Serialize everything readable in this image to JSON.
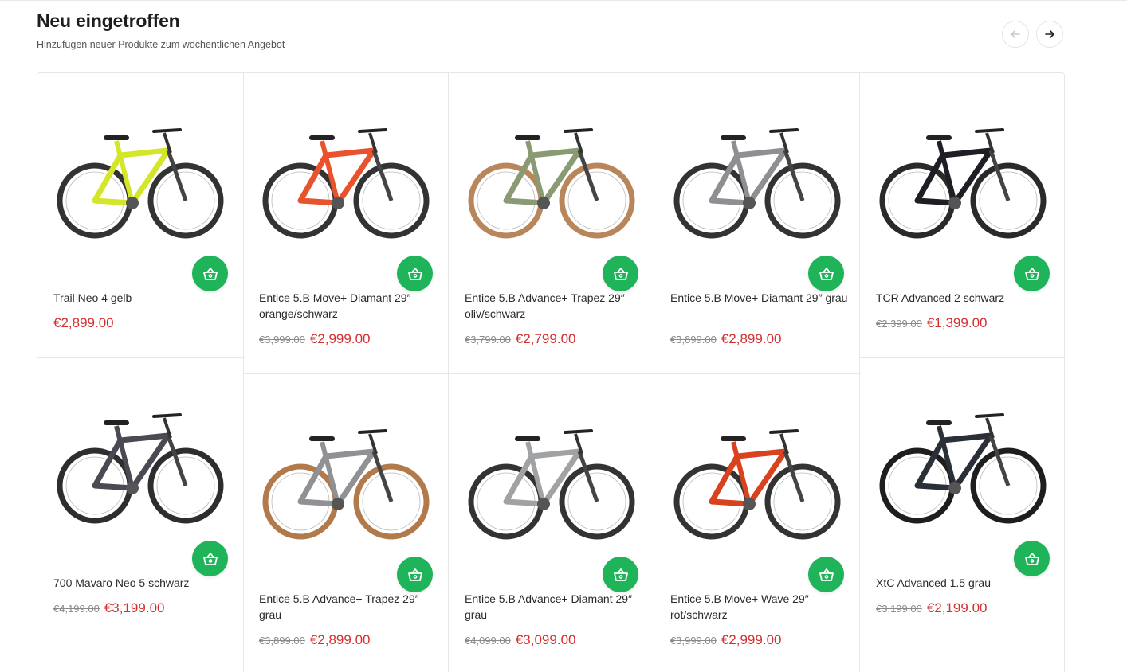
{
  "header": {
    "title": "Neu eingetroffen",
    "subtitle": "Hinzufügen neuer Produkte zum wöchentlichen Angebot",
    "prev_icon": "arrow-left-icon",
    "next_icon": "arrow-right-icon"
  },
  "colors": {
    "accent": "#1fb35a",
    "price": "#d32f2f",
    "old_price": "#8a8a8a",
    "border": "#e6e6e6"
  },
  "products": [
    {
      "name": "Trail Neo 4 gelb",
      "old_price": "",
      "price": "€2,899.00",
      "frame_color": "#d4e62a",
      "tire_color": "#333333"
    },
    {
      "name": "Entice 5.B Move+ Diamant 29″ orange/schwarz",
      "old_price": "€3,999.00",
      "price": "€2,999.00",
      "frame_color": "#e8532d",
      "tire_color": "#333333"
    },
    {
      "name": "Entice 5.B Advance+ Trapez 29″ oliv/schwarz",
      "old_price": "€3,799.00",
      "price": "€2,799.00",
      "frame_color": "#8a9a72",
      "tire_color": "#b8865a"
    },
    {
      "name": "Entice 5.B Move+ Diamant 29″ grau",
      "old_price": "€3,899.00",
      "price": "€2,899.00",
      "frame_color": "#8d8f92",
      "tire_color": "#333333"
    },
    {
      "name": "TCR Advanced 2 schwarz",
      "old_price": "€2,399.00",
      "price": "€1,399.00",
      "frame_color": "#1e1e24",
      "tire_color": "#2a2a2a"
    },
    {
      "name": "700 Mavaro Neo 5 schwarz",
      "old_price": "€4,199.00",
      "price": "€3,199.00",
      "frame_color": "#4a4a52",
      "tire_color": "#2e2e2e"
    },
    {
      "name": "Entice 5.B Advance+ Trapez 29″ grau",
      "old_price": "€3,899.00",
      "price": "€2,899.00",
      "frame_color": "#8f9194",
      "tire_color": "#b27a4a"
    },
    {
      "name": "Entice 5.B Advance+ Diamant 29″ grau",
      "old_price": "€4,099.00",
      "price": "€3,099.00",
      "frame_color": "#a0a2a4",
      "tire_color": "#333333"
    },
    {
      "name": "Entice 5.B Move+ Wave 29″ rot/schwarz",
      "old_price": "€3,999.00",
      "price": "€2,999.00",
      "frame_color": "#d8421f",
      "tire_color": "#333333"
    },
    {
      "name": "XtC Advanced 1.5 grau",
      "old_price": "€3,199.00",
      "price": "€2,199.00",
      "frame_color": "#2b3038",
      "tire_color": "#1e1e1e"
    }
  ]
}
